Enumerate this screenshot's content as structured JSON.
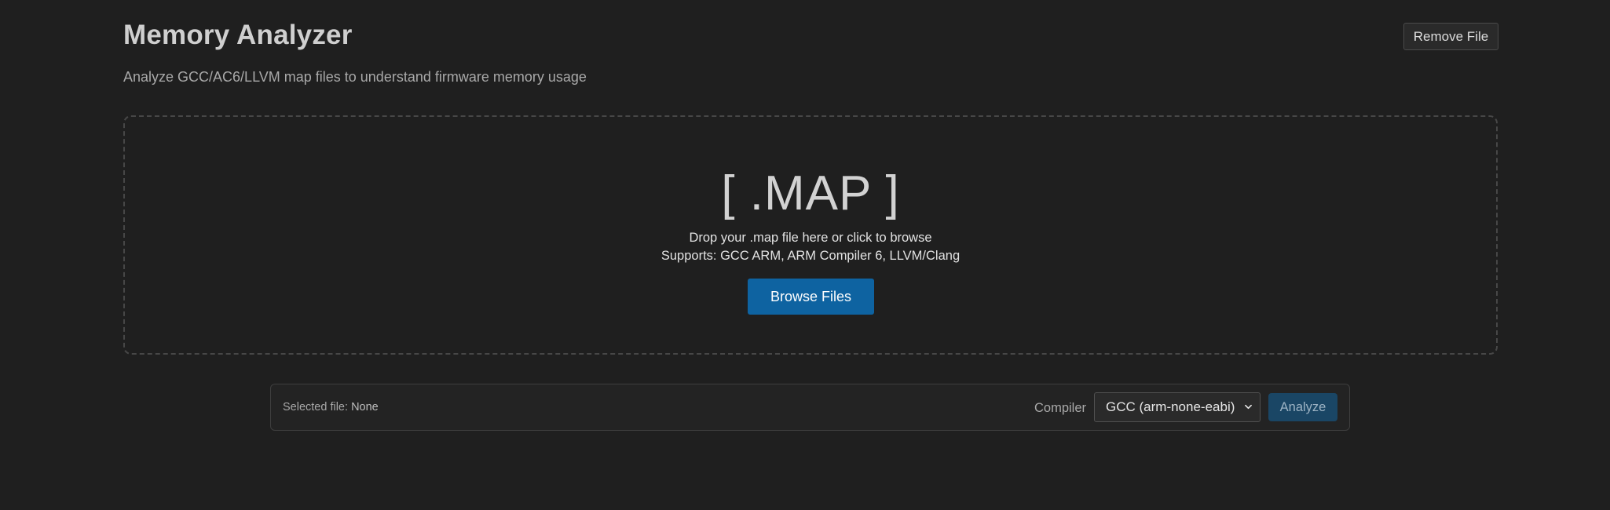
{
  "header": {
    "title": "Memory Analyzer",
    "subtitle": "Analyze GCC/AC6/LLVM map files to understand firmware memory usage",
    "remove_file_label": "Remove File"
  },
  "dropzone": {
    "icon_text": "[ .MAP ]",
    "instruction": "Drop your .map file here or click to browse",
    "supports": "Supports: GCC ARM, ARM Compiler 6, LLVM/Clang",
    "browse_label": "Browse Files"
  },
  "controls": {
    "selected_file_label": "Selected file:",
    "selected_file_value": "None",
    "compiler_label": "Compiler",
    "compiler_selected": "GCC (arm-none-eabi)",
    "analyze_label": "Analyze",
    "analyze_disabled": true
  },
  "colors": {
    "background": "#1f1f1f",
    "accent": "#0e63a1",
    "accent_disabled": "#1a4665"
  }
}
